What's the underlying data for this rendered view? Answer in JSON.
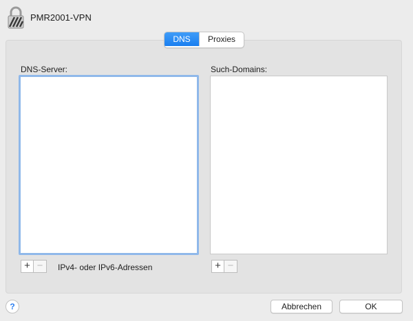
{
  "window": {
    "title": "PMR2001-VPN",
    "icon": "lock-icon"
  },
  "tabs": [
    {
      "label": "DNS",
      "selected": true
    },
    {
      "label": "Proxies",
      "selected": false
    }
  ],
  "dns_servers": {
    "label": "DNS-Server:",
    "items": [],
    "add_label": "+",
    "remove_label": "−",
    "hint": "IPv4- oder IPv6-Adressen"
  },
  "search_domains": {
    "label": "Such-Domains:",
    "items": [],
    "add_label": "+",
    "remove_label": "−"
  },
  "footer": {
    "help_label": "?",
    "cancel_label": "Abbrechen",
    "ok_label": "OK"
  },
  "colors": {
    "accent": "#1a7ff0",
    "focus_ring": "#8fb8ea",
    "background": "#ececec"
  }
}
